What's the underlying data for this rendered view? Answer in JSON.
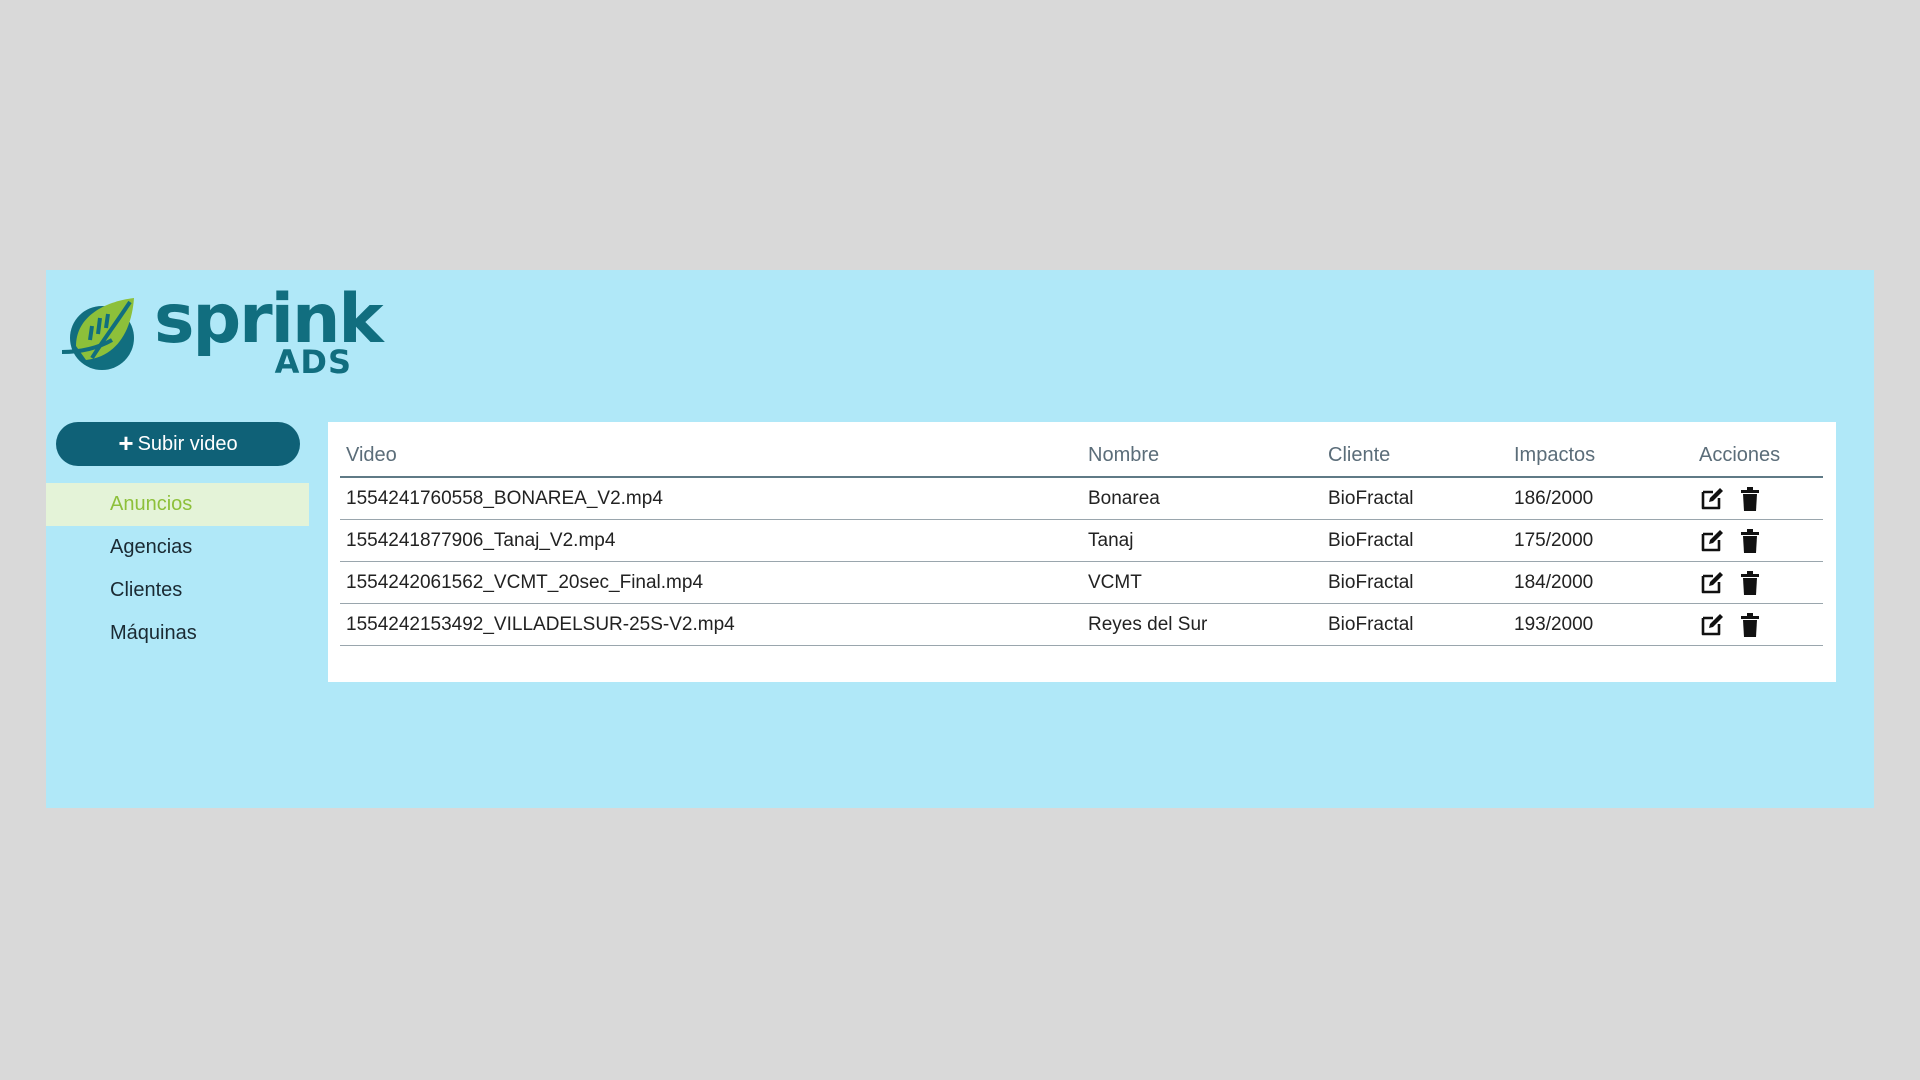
{
  "brand": {
    "name": "sprink",
    "sub": "ADS",
    "colors": {
      "teal": "#116e7f",
      "green": "#8dc03a",
      "background": "#b0e8f8"
    }
  },
  "toolbar": {
    "upload_label": "Subir video"
  },
  "sidebar": {
    "items": [
      {
        "label": "Anuncios",
        "active": true
      },
      {
        "label": "Agencias",
        "active": false
      },
      {
        "label": "Clientes",
        "active": false
      },
      {
        "label": "Máquinas",
        "active": false
      }
    ]
  },
  "table": {
    "headers": [
      "Video",
      "Nombre",
      "Cliente",
      "Impactos",
      "Acciones"
    ],
    "rows": [
      {
        "video": "1554241760558_BONAREA_V2.mp4",
        "name": "Bonarea",
        "client": "BioFractal",
        "impacts": "186/2000"
      },
      {
        "video": "1554241877906_Tanaj_V2.mp4",
        "name": "Tanaj",
        "client": "BioFractal",
        "impacts": "175/2000"
      },
      {
        "video": "1554242061562_VCMT_20sec_Final.mp4",
        "name": "VCMT",
        "client": "BioFractal",
        "impacts": "184/2000"
      },
      {
        "video": "1554242153492_VILLADELSUR-25S-V2.mp4",
        "name": "Reyes del Sur",
        "client": "BioFractal",
        "impacts": "193/2000"
      }
    ],
    "action_icons": [
      "edit-icon",
      "trash-icon"
    ]
  }
}
